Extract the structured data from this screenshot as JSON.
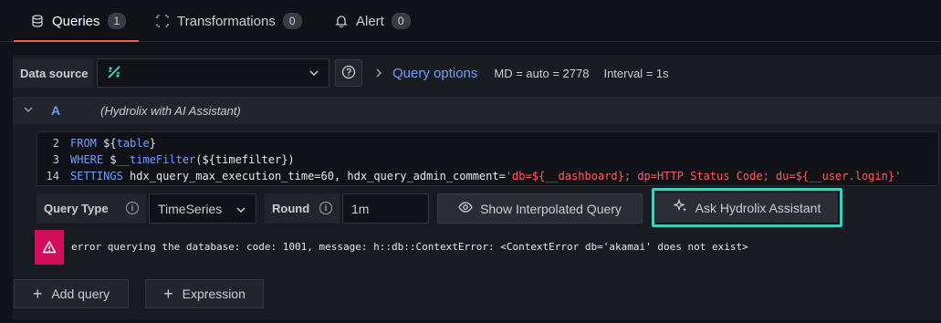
{
  "tabs": [
    {
      "label": "Queries",
      "count": "1",
      "icon": "database-icon"
    },
    {
      "label": "Transformations",
      "count": "0",
      "icon": "transform-icon"
    },
    {
      "label": "Alert",
      "count": "0",
      "icon": "bell-icon"
    }
  ],
  "datasource": {
    "label": "Data source",
    "selected": "",
    "icon": "hydrolix-logo-icon"
  },
  "query_options": {
    "title": "Query options",
    "md": "MD = auto = 2778",
    "interval": "Interval = 1s"
  },
  "query": {
    "ref_id": "A",
    "datasource_name": "(Hydrolix with AI Assistant)"
  },
  "editor": {
    "lines": [
      {
        "num": "2",
        "parts": [
          [
            "kw",
            "FROM"
          ],
          [
            "tx",
            " ${"
          ],
          [
            "kw",
            "table"
          ],
          [
            "tx",
            "}"
          ]
        ]
      },
      {
        "num": "3",
        "parts": [
          [
            "kw",
            "WHERE"
          ],
          [
            "tx",
            " $"
          ],
          [
            "kw",
            "__timeFilter"
          ],
          [
            "tx",
            "(${timefilter})"
          ]
        ]
      },
      {
        "num": "14",
        "parts": [
          [
            "kw",
            "SETTINGS"
          ],
          [
            "tx",
            " hdx_query_max_execution_time=60, hdx_query_admin_comment="
          ],
          [
            "str",
            "'db=${__dashboard}; dp=HTTP Status Code; du=${__user.login}'"
          ]
        ]
      }
    ]
  },
  "controls": {
    "query_type_label": "Query Type",
    "query_type_value": "TimeSeries",
    "round_label": "Round",
    "round_value": "1m",
    "show_interpolated": "Show Interpolated Query",
    "ask_assistant": "Ask Hydrolix Assistant"
  },
  "error": {
    "message": "error querying the database: code: 1001, message: h::db::ContextError: <ContextError db='akamai' does not exist>"
  },
  "actions": {
    "add_query": "Add query",
    "expression": "Expression"
  },
  "colors": {
    "accent_tab": "#f55f3e",
    "link_blue": "#6e9fff",
    "error_red": "#d10e5c",
    "highlight_teal": "#3ecfbf"
  }
}
